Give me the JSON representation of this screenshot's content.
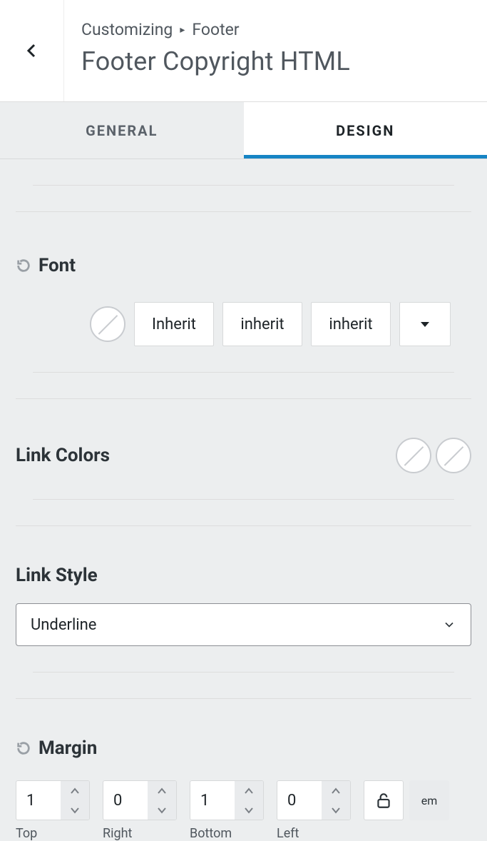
{
  "breadcrumb": {
    "root": "Customizing",
    "parent": "Footer"
  },
  "title": "Footer Copyright HTML",
  "tabs": {
    "general": "General",
    "design": "Design"
  },
  "font": {
    "heading": "Font",
    "family": "Inherit",
    "weight": "inherit",
    "style": "inherit"
  },
  "link_colors": {
    "heading": "Link Colors"
  },
  "link_style": {
    "heading": "Link Style",
    "value": "Underline"
  },
  "margin": {
    "heading": "Margin",
    "top": {
      "value": "1",
      "label": "Top"
    },
    "right": {
      "value": "0",
      "label": "Right"
    },
    "bottom": {
      "value": "1",
      "label": "Bottom"
    },
    "left": {
      "value": "0",
      "label": "Left"
    },
    "unit": "em"
  }
}
